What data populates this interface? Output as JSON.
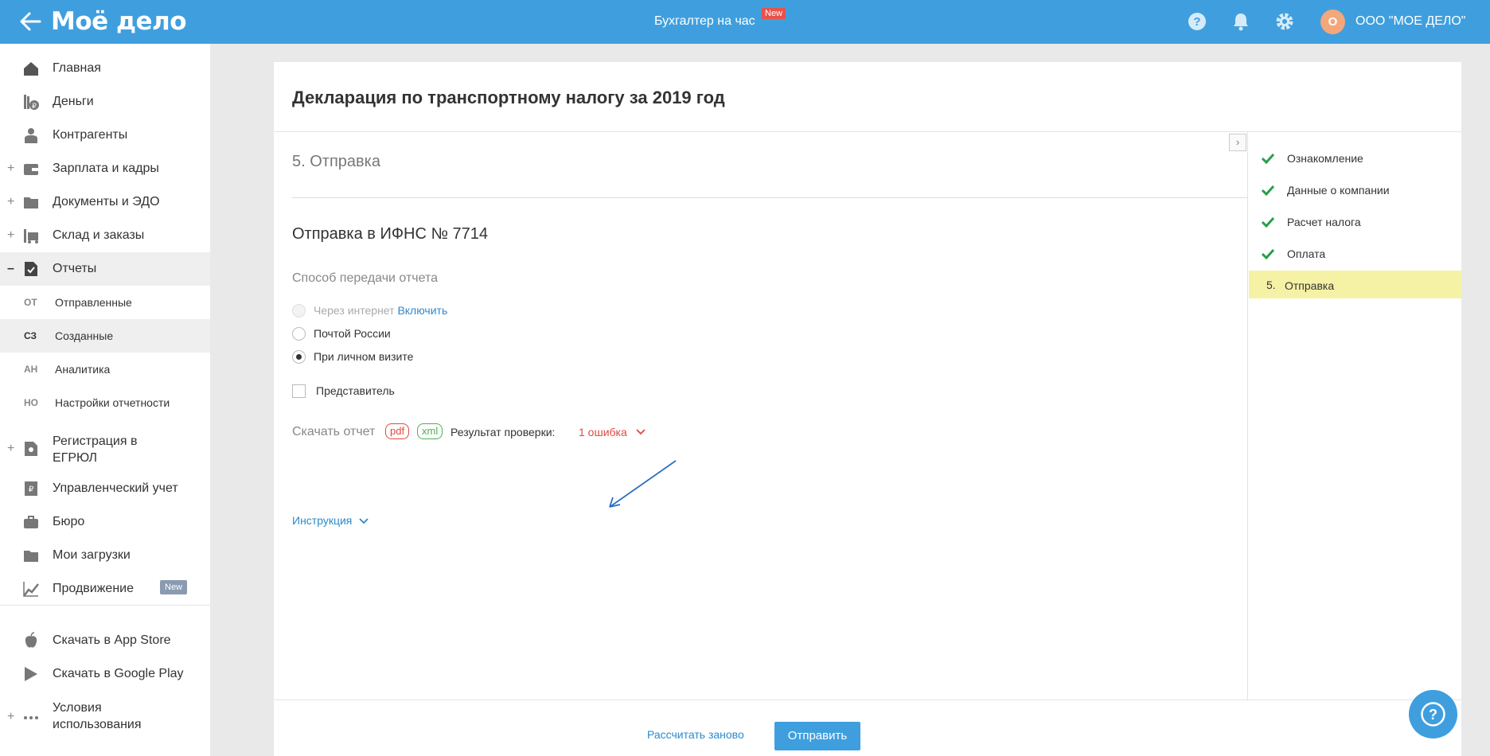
{
  "header": {
    "logo": "Моё дело",
    "center_link": "Бухгалтер на час",
    "center_badge": "New",
    "avatar_letter": "О",
    "company": "ООО \"МОЕ ДЕЛО\"",
    "accent": "#3f9fde"
  },
  "sidebar": {
    "items": [
      {
        "label": "Главная",
        "icon": "home-icon",
        "expandable": false
      },
      {
        "label": "Деньги",
        "icon": "money-icon",
        "expandable": false
      },
      {
        "label": "Контрагенты",
        "icon": "contractors-icon",
        "expandable": false
      },
      {
        "label": "Зарплата и кадры",
        "icon": "wallet-icon",
        "expandable": true
      },
      {
        "label": "Документы и ЭДО",
        "icon": "folder-icon",
        "expandable": true
      },
      {
        "label": "Склад и заказы",
        "icon": "warehouse-icon",
        "expandable": true
      },
      {
        "label": "Отчеты",
        "icon": "report-icon",
        "expandable": true,
        "expanded": true
      }
    ],
    "subitems": [
      {
        "abbr": "ОТ",
        "label": "Отправленные"
      },
      {
        "abbr": "СЗ",
        "label": "Созданные",
        "selected": true
      },
      {
        "abbr": "АН",
        "label": "Аналитика"
      },
      {
        "abbr": "НО",
        "label": "Настройки отчетности"
      }
    ],
    "items2": [
      {
        "label_line1": "Регистрация в",
        "label_line2": "ЕГРЮЛ",
        "icon": "registration-icon",
        "expandable": true
      },
      {
        "label": "Управленческий учет",
        "icon": "management-icon"
      },
      {
        "label": "Бюро",
        "icon": "briefcase-icon"
      },
      {
        "label": "Мои загрузки",
        "icon": "downloads-icon"
      },
      {
        "label": "Продвижение",
        "icon": "chart-icon",
        "badge": "New"
      }
    ],
    "items3": [
      {
        "label": "Скачать в App Store",
        "icon": "apple-icon"
      },
      {
        "label": "Скачать в Google Play",
        "icon": "google-play-icon"
      },
      {
        "label_line1": "Условия",
        "label_line2": "использования",
        "icon": "more-icon",
        "expandable": true
      }
    ]
  },
  "main": {
    "title": "Декларация по транспортному налогу за 2019 год",
    "step_title": "5. Отправка",
    "section_title": "Отправка в ИФНС № 7714",
    "subsection": "Способ передачи отчета",
    "radios": [
      {
        "label": "Через интернет",
        "link": "Включить",
        "disabled": true,
        "checked": false
      },
      {
        "label": "Почтой России",
        "disabled": false,
        "checked": false
      },
      {
        "label": "При личном визите",
        "disabled": false,
        "checked": true
      }
    ],
    "checkbox_label": "Представитель",
    "download_label": "Скачать отчет",
    "pdf_label": "pdf",
    "xml_label": "xml",
    "check_result_label": "Результат проверки:",
    "errors_label": "1 ошибка",
    "instruction_label": "Инструкция"
  },
  "steps": [
    {
      "label": "Ознакомление",
      "done": true
    },
    {
      "label": "Данные о компании",
      "done": true
    },
    {
      "label": "Расчет налога",
      "done": true
    },
    {
      "label": "Оплата",
      "done": true
    },
    {
      "num": "5.",
      "label": "Отправка",
      "current": true
    }
  ],
  "footer": {
    "recalc_label": "Рассчитать заново",
    "send_label": "Отправить"
  }
}
